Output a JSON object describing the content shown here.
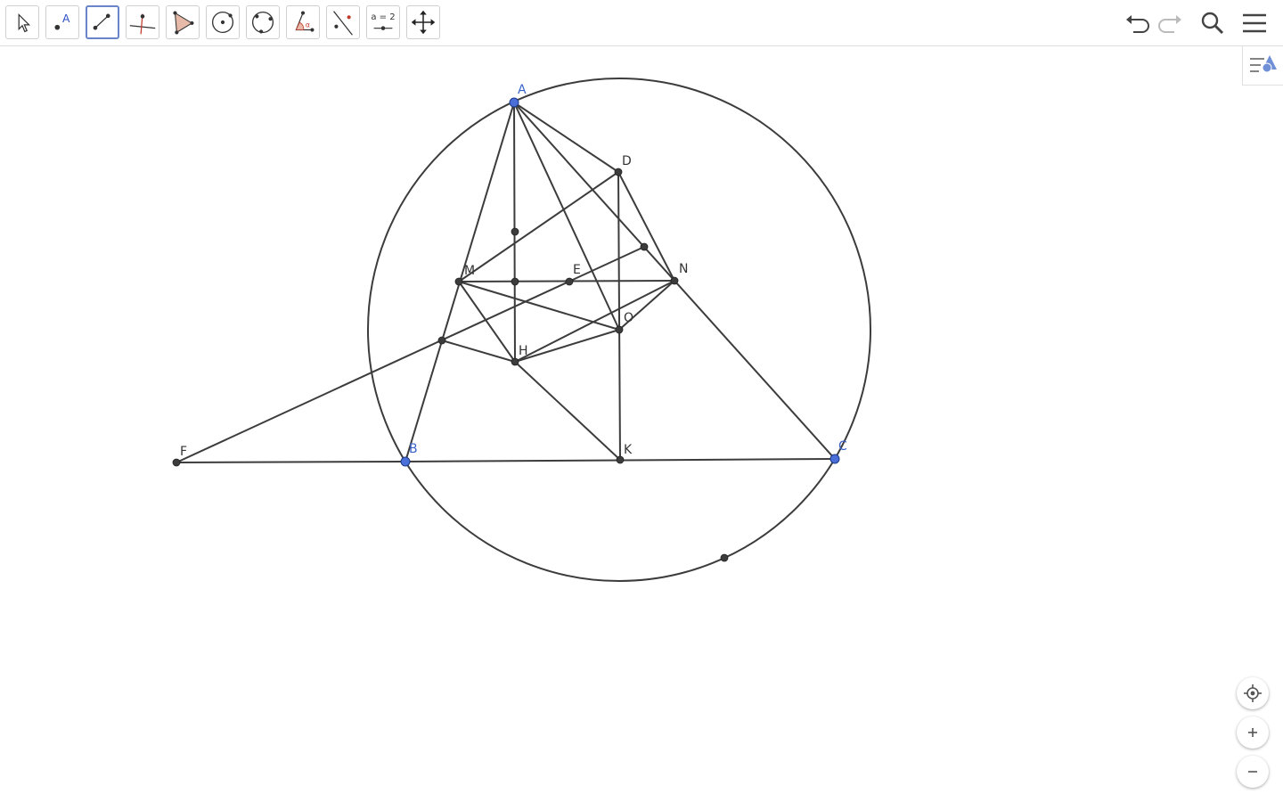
{
  "app": {
    "accent": "#6a84c9"
  },
  "toolbar": {
    "tools": [
      {
        "name": "move",
        "icon": "arrow-cursor-icon"
      },
      {
        "name": "point",
        "icon": "point-icon"
      },
      {
        "name": "segment",
        "icon": "segment-icon",
        "active": true
      },
      {
        "name": "perpendicular-line",
        "icon": "perpendicular-icon"
      },
      {
        "name": "polygon",
        "icon": "polygon-icon"
      },
      {
        "name": "circle-center-point",
        "icon": "circle-icon"
      },
      {
        "name": "circle-three-points",
        "icon": "circle-three-points-icon"
      },
      {
        "name": "angle",
        "icon": "angle-icon"
      },
      {
        "name": "reflect",
        "icon": "reflect-icon"
      },
      {
        "name": "slider",
        "icon": "slider-icon",
        "label": "a = 2"
      },
      {
        "name": "move-graphics-view",
        "icon": "move-view-icon"
      }
    ],
    "right": [
      "undo-icon",
      "redo-icon",
      "search-icon",
      "menu-icon"
    ]
  },
  "colors": {
    "free_point": "#4a6fd8",
    "dependent_point": "#3c3c3c",
    "line": "#3c3c3c",
    "free_label": "#3a63c9",
    "label": "#333333"
  },
  "points": {
    "A": {
      "label": "A",
      "free": true
    },
    "B": {
      "label": "B",
      "free": true
    },
    "C": {
      "label": "C",
      "free": true
    },
    "D": {
      "label": "D"
    },
    "E": {
      "label": "E"
    },
    "F": {
      "label": "F"
    },
    "H": {
      "label": "H"
    },
    "K": {
      "label": "K"
    },
    "M": {
      "label": "M"
    },
    "N": {
      "label": "N"
    },
    "O": {
      "label": "O"
    }
  },
  "zoom_controls": [
    "standard-view-icon",
    "zoom-in-icon",
    "zoom-out-icon"
  ]
}
